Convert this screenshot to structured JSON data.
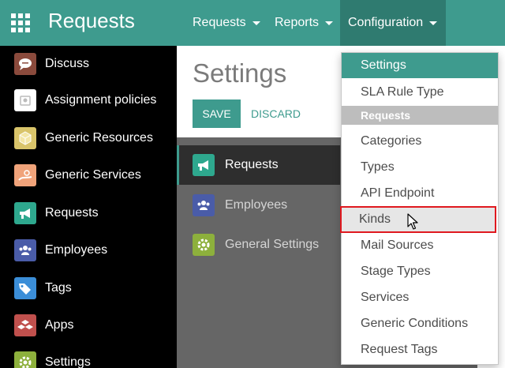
{
  "topbar": {
    "app_title": "Requests",
    "menus": [
      {
        "label": "Requests"
      },
      {
        "label": "Reports"
      },
      {
        "label": "Configuration"
      }
    ]
  },
  "sidebar": {
    "items": [
      {
        "label": "Discuss",
        "icon": "discuss-icon",
        "color": "#8a4a3c"
      },
      {
        "label": "Assignment policies",
        "icon": "assignment-icon",
        "color": "#ffffff"
      },
      {
        "label": "Generic Resources",
        "icon": "cube-icon",
        "color": "#d9c46a"
      },
      {
        "label": "Generic Services",
        "icon": "services-icon",
        "color": "#f0a37a"
      },
      {
        "label": "Requests",
        "icon": "megaphone-icon",
        "color": "#2ea88e"
      },
      {
        "label": "Employees",
        "icon": "employees-icon",
        "color": "#4a5ca8"
      },
      {
        "label": "Tags",
        "icon": "tags-icon",
        "color": "#3b8ed8"
      },
      {
        "label": "Apps",
        "icon": "apps-icon",
        "color": "#c0504d"
      },
      {
        "label": "Settings",
        "icon": "gear-icon",
        "color": "#8db03c"
      }
    ]
  },
  "main": {
    "title": "Settings",
    "save_label": "SAVE",
    "discard_label": "DISCARD",
    "settings_tabs": [
      {
        "label": "Requests",
        "icon": "megaphone-icon"
      },
      {
        "label": "Employees",
        "icon": "employees-icon"
      },
      {
        "label": "General Settings",
        "icon": "gear-icon"
      }
    ]
  },
  "dropdown": {
    "items": [
      {
        "label": "Settings"
      },
      {
        "label": "SLA Rule Type"
      },
      {
        "label": "Requests",
        "type": "header"
      },
      {
        "label": "Categories"
      },
      {
        "label": "Types"
      },
      {
        "label": "API Endpoint"
      },
      {
        "label": "Kinds"
      },
      {
        "label": "Mail Sources"
      },
      {
        "label": "Stage Types"
      },
      {
        "label": "Services"
      },
      {
        "label": "Generic Conditions"
      },
      {
        "label": "Request Tags"
      }
    ]
  },
  "colors": {
    "brand": "#3e9b8e",
    "highlight_border": "#e0191f"
  }
}
